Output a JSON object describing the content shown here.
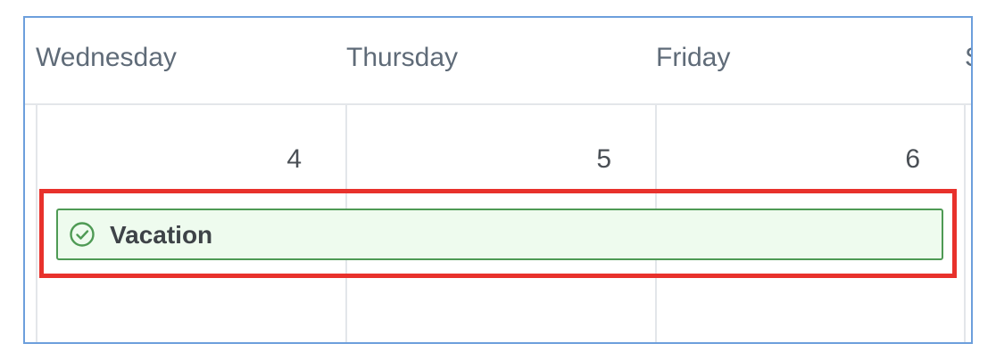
{
  "calendar": {
    "days": [
      {
        "label": "Wednesday",
        "date": "4"
      },
      {
        "label": "Thursday",
        "date": "5"
      },
      {
        "label": "Friday",
        "date": "6"
      },
      {
        "label": "S",
        "date": ""
      }
    ],
    "event": {
      "label": "Vacation",
      "icon": "check-circle-icon",
      "status_color": "#4e9a54",
      "background_color": "#eefbee"
    },
    "highlight_color": "#e8312c",
    "frame_color": "#6d9fdc"
  }
}
